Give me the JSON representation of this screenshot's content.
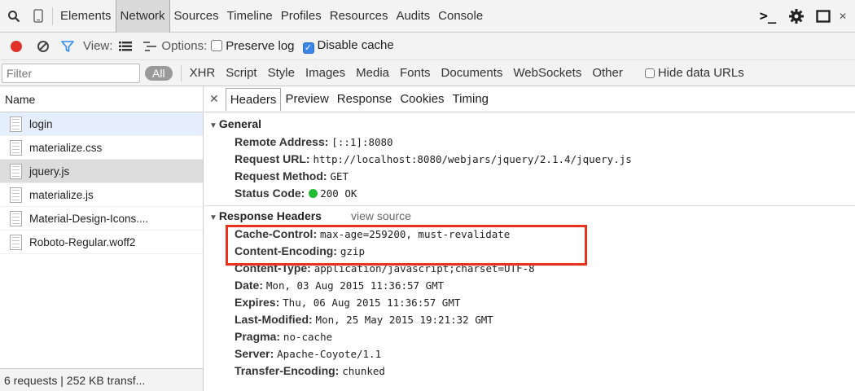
{
  "tabs": [
    "Elements",
    "Network",
    "Sources",
    "Timeline",
    "Profiles",
    "Resources",
    "Audits",
    "Console"
  ],
  "toolbar": {
    "view_label": "View:",
    "options_label": "Options:",
    "preserve_log": "Preserve log",
    "disable_cache": "Disable cache",
    "disable_cache_checked": true,
    "preserve_log_checked": false
  },
  "filterbar": {
    "filter_placeholder": "Filter",
    "all_label": "All",
    "types": [
      "XHR",
      "Script",
      "Style",
      "Images",
      "Media",
      "Fonts",
      "Documents",
      "WebSockets",
      "Other"
    ],
    "hide_data_urls": "Hide data URLs"
  },
  "requests": {
    "header": "Name",
    "items": [
      "login",
      "materialize.css",
      "jquery.js",
      "materialize.js",
      "Material-Design-Icons....",
      "Roboto-Regular.woff2"
    ],
    "status": "6 requests | 252 KB transf..."
  },
  "detail": {
    "tabs": [
      "Headers",
      "Preview",
      "Response",
      "Cookies",
      "Timing"
    ],
    "general": {
      "title": "General",
      "rows": [
        {
          "k": "Remote Address:",
          "v": "[::1]:8080"
        },
        {
          "k": "Request URL:",
          "v": "http://localhost:8080/webjars/jquery/2.1.4/jquery.js"
        },
        {
          "k": "Request Method:",
          "v": "GET"
        },
        {
          "k": "Status Code:",
          "v": "200 OK"
        }
      ]
    },
    "response": {
      "title": "Response Headers",
      "view_source": "view source",
      "rows": [
        {
          "k": "Cache-Control:",
          "v": "max-age=259200, must-revalidate"
        },
        {
          "k": "Content-Encoding:",
          "v": "gzip"
        },
        {
          "k": "Content-Type:",
          "v": "application/javascript;charset=UTF-8"
        },
        {
          "k": "Date:",
          "v": "Mon, 03 Aug 2015 11:36:57 GMT"
        },
        {
          "k": "Expires:",
          "v": "Thu, 06 Aug 2015 11:36:57 GMT"
        },
        {
          "k": "Last-Modified:",
          "v": "Mon, 25 May 2015 19:21:32 GMT"
        },
        {
          "k": "Pragma:",
          "v": "no-cache"
        },
        {
          "k": "Server:",
          "v": "Apache-Coyote/1.1"
        },
        {
          "k": "Transfer-Encoding:",
          "v": "chunked"
        }
      ]
    }
  },
  "colors": {
    "status_ok": "#22bb33",
    "highlight": "#e8321e",
    "record": "#e0322b",
    "filter_icon": "#2d8cf0"
  },
  "icons": {
    "search": "search-icon",
    "device": "device-icon",
    "console": "console-prompt-icon",
    "settings": "gear-icon",
    "dock": "dock-icon",
    "close": "close-icon",
    "record": "record-icon",
    "clear": "clear-icon",
    "filter": "filter-icon",
    "large_rows": "large-rows-icon",
    "overview": "overview-icon",
    "file": "file-icon"
  }
}
